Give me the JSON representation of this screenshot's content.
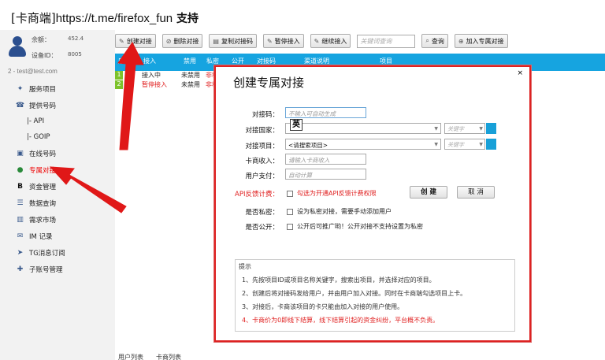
{
  "title": {
    "prefix": "[卡商端]",
    "url": "https://t.me/firefox_fun",
    "suffix": " 支持"
  },
  "account": {
    "balance_label": "余额：",
    "balance_value": "452.4",
    "device_label": "设备ID：",
    "device_value": "8005",
    "user": "2 - test@test.com"
  },
  "sidebar": {
    "items": [
      {
        "label": "服务项目",
        "icon": "service-icon"
      },
      {
        "label": "提供号码",
        "icon": "phone-icon"
      },
      {
        "label": "|-  API",
        "icon": ""
      },
      {
        "label": "|-  GOIP",
        "icon": ""
      },
      {
        "label": "在线号码",
        "icon": "online-icon"
      },
      {
        "label": "专属对接",
        "icon": "globe-icon"
      },
      {
        "label": "资金管理",
        "icon": "bitcoin-icon"
      },
      {
        "label": "数据查询",
        "icon": "list-icon"
      },
      {
        "label": "需求市场",
        "icon": "chart-icon"
      },
      {
        "label": "IM 记录",
        "icon": "mail-icon"
      },
      {
        "label": "TG消息订阅",
        "icon": "telegram-icon"
      },
      {
        "label": "子账号管理",
        "icon": "users-icon"
      }
    ]
  },
  "toolbar": {
    "create": "创建对接",
    "delete": "删除对接",
    "copy": "复制对接码",
    "pause": "暂停接入",
    "resume": "继续接入",
    "search_placeholder": "关键词查询",
    "search": "查询",
    "join": "加入专属对接"
  },
  "table": {
    "headers": [
      "序号",
      "接入",
      "禁用",
      "私密",
      "公开",
      "对接码",
      "渠道说明",
      "项目"
    ],
    "rows": [
      {
        "num": "1",
        "access": "接入中",
        "disabled": "未禁用",
        "private": "非私"
      },
      {
        "num": "2",
        "access": "暂停接入",
        "disabled": "未禁用",
        "private": "非私"
      }
    ]
  },
  "bottom_tabs": "用户列表　　卡商列表",
  "dialog": {
    "title": "创建专属对接",
    "close": "×",
    "fields": {
      "code_label": "对接码：",
      "code_placeholder": "不输入可自动生成",
      "country_label": "对接国家：",
      "project_label": "对接项目：",
      "project_value": "<请搜索项目>",
      "keyword_placeholder": "关键字",
      "income_label": "卡商收入：",
      "income_placeholder": "请输入卡商收入",
      "pay_label": "用户支付：",
      "pay_placeholder": "自动计算",
      "api_label": "API反馈计费：",
      "api_check": "勾选为开通API反馈计费权限",
      "private_label": "是否私密：",
      "private_check": "设为私密对接，需要手动添加用户",
      "public_label": "是否公开：",
      "public_check": "公开后可推广哟！公开对接不支持设置为私密"
    },
    "ime": "英",
    "create_btn": "创 建",
    "cancel_btn": "取 消",
    "tips_title": "提示",
    "tips": [
      "1、先按项目ID或项目名称关键字，搜索出项目，并选择对应的项目。",
      "2、创建后将对接码发给用户，并由用户加入对接。同时在卡商端勾选项目上卡。",
      "3、对接后，卡商该项目的卡只能由加入对接的用户使用。",
      "4、卡商价为0即线下结算，线下结算引起的资金纠纷，平台概不负责。"
    ]
  },
  "colors": {
    "accent": "#16a4e0",
    "highlight": "#e02020",
    "arrow": "#e01818"
  }
}
